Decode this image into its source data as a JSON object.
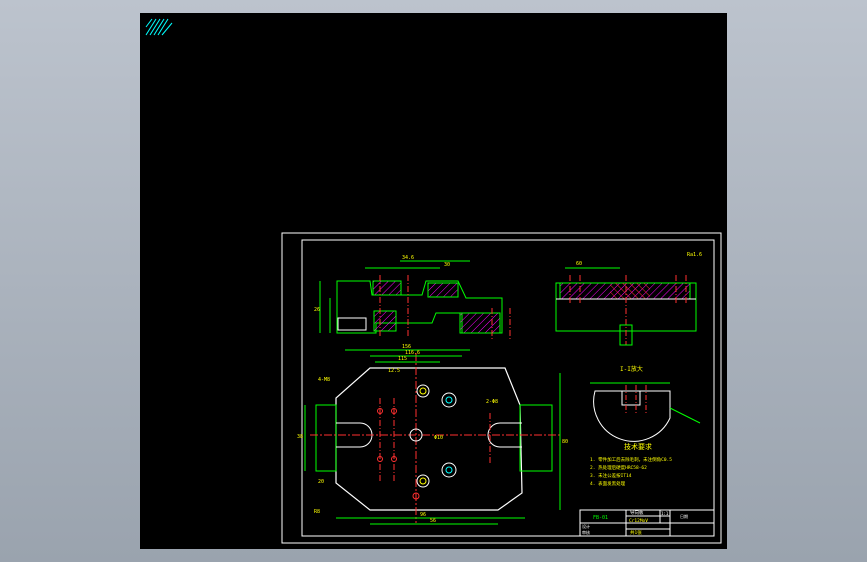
{
  "colors": {
    "background": "#000000",
    "frame": "#ffffff",
    "outline": "#00ff00",
    "centerline": "#ff3030",
    "hatch": "#ff00ff",
    "dimension": "#00ff00",
    "text": "#ffff00",
    "ucs_icon": "#00ffff"
  },
  "icons": {
    "ucs": "ucs-icon"
  },
  "titles": {
    "view_detail": "I-I放大",
    "tech_req": "技术要求"
  },
  "tech_notes": [
    "1. 零件加工后去除毛刺，未注倒角C0.5",
    "2. 热处理后硬度HRC58-62",
    "3. 未注公差按IT14",
    "4. 表面发黑处理"
  ],
  "dims": {
    "d1": "34.6",
    "d2": "30",
    "d3": "26",
    "d4": "60",
    "d5": "156",
    "d6": "116.6",
    "d7": "115",
    "d8": "96",
    "d9": "56",
    "d10": "38",
    "d11": "80",
    "d12": "20",
    "d13": "4-M8",
    "d14": "2-Φ8",
    "d15": "Φ10",
    "d16": "R8",
    "d17": "12.5",
    "d18": "Ra1.6"
  },
  "title_block": {
    "drawing_no": "FB-01",
    "part_name": "导向板",
    "material": "Cr12MoV",
    "scale": "1:1",
    "sheet": "共1张",
    "label_design": "设计",
    "label_check": "审核",
    "label_date": "日期"
  }
}
